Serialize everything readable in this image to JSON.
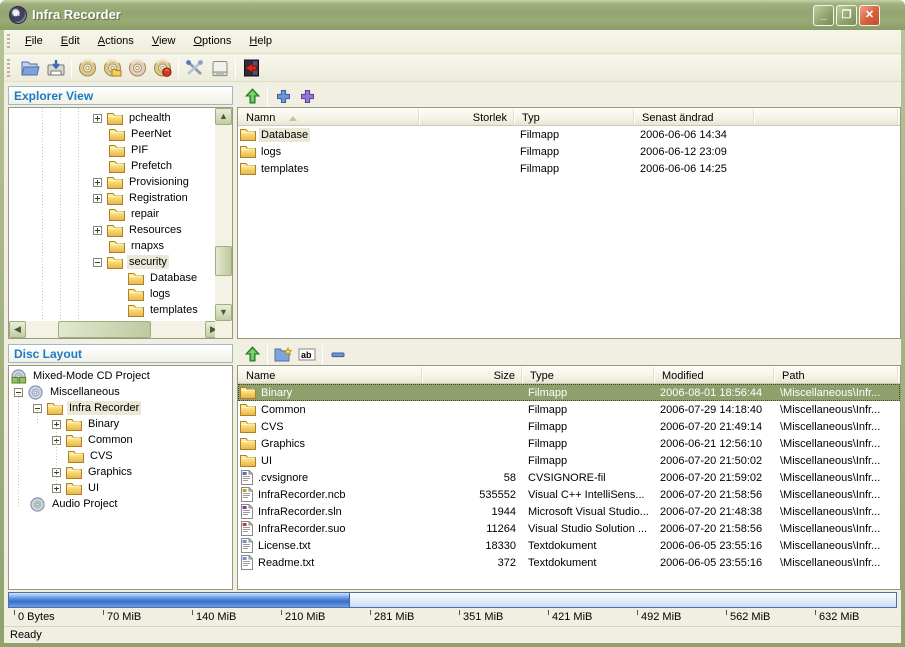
{
  "window": {
    "title": "Infra Recorder"
  },
  "menu": {
    "items": [
      {
        "label": "File"
      },
      {
        "label": "Edit"
      },
      {
        "label": "Actions"
      },
      {
        "label": "View"
      },
      {
        "label": "Options"
      },
      {
        "label": "Help"
      }
    ]
  },
  "toolbar": {
    "buttons": [
      {
        "icon": "open-project-icon"
      },
      {
        "icon": "save-project-icon"
      },
      {
        "sep": true
      },
      {
        "icon": "burn-compilation-icon"
      },
      {
        "icon": "burn-image-icon"
      },
      {
        "icon": "copy-disc-icon"
      },
      {
        "icon": "erase-disc-icon"
      },
      {
        "sep": true
      },
      {
        "icon": "tools-icon"
      },
      {
        "icon": "device-icon"
      },
      {
        "sep": true
      },
      {
        "icon": "exit-icon"
      }
    ]
  },
  "explorer_panel": {
    "title": "Explorer View",
    "tools": [
      {
        "icon": "up-folder-icon"
      },
      {
        "sep": true
      },
      {
        "icon": "add-icon"
      },
      {
        "icon": "add-all-icon"
      }
    ]
  },
  "disc_panel": {
    "title": "Disc Layout",
    "tools": [
      {
        "icon": "up-folder-icon"
      },
      {
        "sep": true
      },
      {
        "icon": "new-folder-icon"
      },
      {
        "icon": "rename-icon"
      },
      {
        "sep": true
      },
      {
        "icon": "remove-icon"
      }
    ]
  },
  "explorer_tree": {
    "items": [
      {
        "label": "pchealth",
        "level": 0,
        "expander": "plus",
        "icon": "folder-icon"
      },
      {
        "label": "PeerNet",
        "level": 0,
        "icon": "folder-icon"
      },
      {
        "label": "PIF",
        "level": 0,
        "icon": "folder-icon"
      },
      {
        "label": "Prefetch",
        "level": 0,
        "icon": "folder-icon"
      },
      {
        "label": "Provisioning",
        "level": 0,
        "expander": "plus",
        "icon": "folder-icon"
      },
      {
        "label": "Registration",
        "level": 0,
        "expander": "plus",
        "icon": "folder-icon"
      },
      {
        "label": "repair",
        "level": 0,
        "icon": "folder-icon"
      },
      {
        "label": "Resources",
        "level": 0,
        "expander": "plus",
        "icon": "folder-icon"
      },
      {
        "label": "rnapxs",
        "level": 0,
        "icon": "folder-icon"
      },
      {
        "label": "security",
        "level": 0,
        "expander": "minus",
        "icon": "folder-icon",
        "selected": "inactive"
      },
      {
        "label": "Database",
        "level": 1,
        "icon": "folder-icon"
      },
      {
        "label": "logs",
        "level": 1,
        "icon": "folder-icon"
      },
      {
        "label": "templates",
        "level": 1,
        "icon": "folder-icon"
      }
    ]
  },
  "explorer_list": {
    "columns": [
      {
        "label": "Namn",
        "sort": "asc"
      },
      {
        "label": "Storlek",
        "align": "right"
      },
      {
        "label": "Typ"
      },
      {
        "label": "Senast ändrad"
      },
      {
        "label": ""
      }
    ],
    "rows": [
      {
        "icon": "folder-icon",
        "name": "Database",
        "size": "",
        "type": "Filmapp",
        "modified": "2006-06-06 14:34",
        "selected": "inactive"
      },
      {
        "icon": "folder-icon",
        "name": "logs",
        "size": "",
        "type": "Filmapp",
        "modified": "2006-06-12 23:09"
      },
      {
        "icon": "folder-icon",
        "name": "templates",
        "size": "",
        "type": "Filmapp",
        "modified": "2006-06-06 14:25"
      }
    ]
  },
  "disc_tree": {
    "items": [
      {
        "label": "Mixed-Mode CD Project",
        "level": 0,
        "icon": "mixed-mode-project-icon"
      },
      {
        "label": "Miscellaneous",
        "level": 1,
        "expander": "minus",
        "icon": "data-disc-icon"
      },
      {
        "label": "Infra Recorder",
        "level": 2,
        "expander": "minus",
        "icon": "folder-icon",
        "selected": "inactive"
      },
      {
        "label": "Binary",
        "level": 3,
        "expander": "plus",
        "icon": "folder-icon"
      },
      {
        "label": "Common",
        "level": 3,
        "expander": "plus",
        "icon": "folder-icon"
      },
      {
        "label": "CVS",
        "level": 3,
        "icon": "folder-icon"
      },
      {
        "label": "Graphics",
        "level": 3,
        "expander": "plus",
        "icon": "folder-icon"
      },
      {
        "label": "UI",
        "level": 3,
        "expander": "plus",
        "icon": "folder-icon"
      },
      {
        "label": "Audio Project",
        "level": 1,
        "icon": "audio-disc-icon"
      }
    ]
  },
  "disc_list": {
    "columns": [
      {
        "label": "Name"
      },
      {
        "label": "Size",
        "align": "right"
      },
      {
        "label": "Type"
      },
      {
        "label": "Modified"
      },
      {
        "label": "Path"
      }
    ],
    "rows": [
      {
        "icon": "folder-icon",
        "name": "Binary",
        "size": "",
        "type": "Filmapp",
        "modified": "2006-08-01 18:56:44",
        "path": "\\Miscellaneous\\Infr...",
        "selected": "active"
      },
      {
        "icon": "folder-icon",
        "name": "Common",
        "size": "",
        "type": "Filmapp",
        "modified": "2006-07-29 14:18:40",
        "path": "\\Miscellaneous\\Infr..."
      },
      {
        "icon": "folder-icon",
        "name": "CVS",
        "size": "",
        "type": "Filmapp",
        "modified": "2006-07-20 21:49:14",
        "path": "\\Miscellaneous\\Infr..."
      },
      {
        "icon": "folder-icon",
        "name": "Graphics",
        "size": "",
        "type": "Filmapp",
        "modified": "2006-06-21 12:56:10",
        "path": "\\Miscellaneous\\Infr..."
      },
      {
        "icon": "folder-icon",
        "name": "UI",
        "size": "",
        "type": "Filmapp",
        "modified": "2006-07-20 21:50:02",
        "path": "\\Miscellaneous\\Infr..."
      },
      {
        "icon": "cvs-file-icon",
        "name": ".cvsignore",
        "size": "58",
        "type": "CVSIGNORE-fil",
        "modified": "2006-07-20 21:59:02",
        "path": "\\Miscellaneous\\Infr..."
      },
      {
        "icon": "ncb-file-icon",
        "name": "InfraRecorder.ncb",
        "size": "535552",
        "type": "Visual C++ IntelliSens...",
        "modified": "2006-07-20 21:58:56",
        "path": "\\Miscellaneous\\Infr..."
      },
      {
        "icon": "sln-file-icon",
        "name": "InfraRecorder.sln",
        "size": "1944",
        "type": "Microsoft Visual Studio...",
        "modified": "2006-07-20 21:48:38",
        "path": "\\Miscellaneous\\Infr..."
      },
      {
        "icon": "suo-file-icon",
        "name": "InfraRecorder.suo",
        "size": "11264",
        "type": "Visual Studio Solution ...",
        "modified": "2006-07-20 21:58:56",
        "path": "\\Miscellaneous\\Infr..."
      },
      {
        "icon": "txt-file-icon",
        "name": "License.txt",
        "size": "18330",
        "type": "Textdokument",
        "modified": "2006-06-05 23:55:16",
        "path": "\\Miscellaneous\\Infr..."
      },
      {
        "icon": "txt-file-icon",
        "name": "Readme.txt",
        "size": "372",
        "type": "Textdokument",
        "modified": "2006-06-05 23:55:16",
        "path": "\\Miscellaneous\\Infr..."
      }
    ]
  },
  "capacity": {
    "filled_percent": 38.5,
    "labels": [
      "0 Bytes",
      "70 MiB",
      "140 MiB",
      "210 MiB",
      "281 MiB",
      "351 MiB",
      "421 MiB",
      "492 MiB",
      "562 MiB",
      "632 MiB"
    ]
  },
  "statusbar": {
    "text": "Ready"
  }
}
